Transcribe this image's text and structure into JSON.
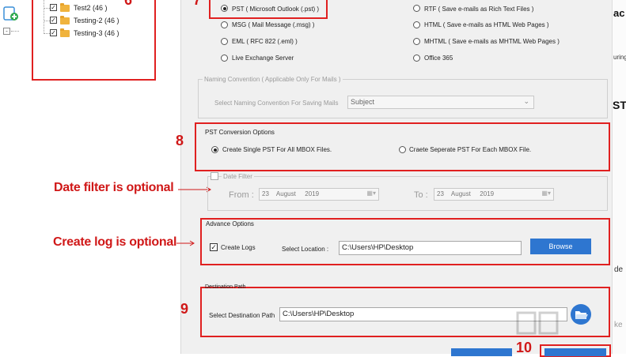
{
  "tree": {
    "items": [
      {
        "label": "Test2 (46 )"
      },
      {
        "label": "Testing-2 (46 )"
      },
      {
        "label": "Testing-3 (46 )"
      }
    ]
  },
  "annotations": {
    "step6": "6",
    "step7": "7",
    "step8": "8",
    "step9": "9",
    "step10": "10",
    "date_filter_note": "Date filter is optional",
    "create_log_note": "Create log is optional"
  },
  "formats": {
    "pst": "PST ( Microsoft Outlook (.pst) )",
    "rtf": "RTF ( Save e-mails as Rich Text Files )",
    "msg": "MSG ( Mail Message (.msg) )",
    "html": "HTML ( Save e-mails as HTML Web Pages )",
    "eml": "EML ( RFC 822 (.eml) )",
    "mhtml": "MHTML ( Save e-mails as MHTML Web Pages )",
    "live": "Live Exchange Server",
    "o365": "Office 365"
  },
  "naming": {
    "group_label": "Naming Convention ( Applicable Only For Mails )",
    "field_label": "Select Naming Convention For Saving Mails",
    "value": "Subject"
  },
  "pst_options": {
    "group_label": "PST Conversion Options",
    "single": "Create Single PST For All MBOX Files.",
    "separate": "Craete Seperate PST  For Each MBOX File."
  },
  "date_filter": {
    "checkbox_label": "Date Filter",
    "from_label": "From :",
    "from_day": "23",
    "from_month": "August",
    "from_year": "2019",
    "to_label": "To :",
    "to_day": "23",
    "to_month": "August",
    "to_year": "2019"
  },
  "advance": {
    "group_label": "Advance Options",
    "create_logs": "Create Logs",
    "location_label": "Select Location :",
    "location_value": "C:\\Users\\HP\\Desktop",
    "browse": "Browse"
  },
  "destination": {
    "group_label": "Destination Path",
    "field_label": "Select Destination Path",
    "value": "C:\\Users\\HP\\Desktop"
  },
  "right_edge": {
    "t1": "ac",
    "t2": "uring",
    "t3": "ST",
    "t4": "de",
    "t5": "ke"
  },
  "colors": {
    "annotation_red": "#e02020",
    "button_blue": "#2e76d0"
  }
}
